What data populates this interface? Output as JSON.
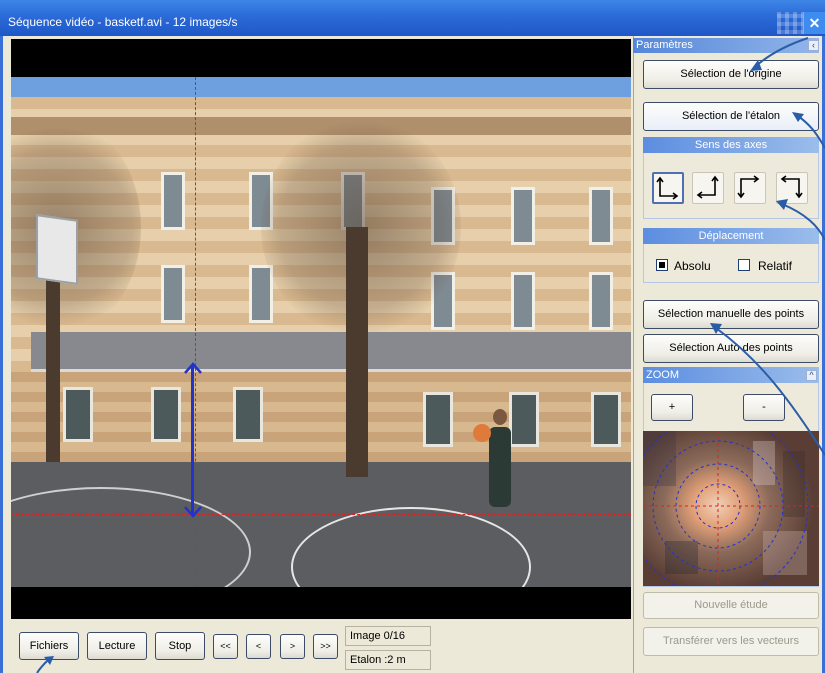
{
  "window": {
    "title": "Séquence vidéo - basketf.avi - 12 images/s",
    "close_glyph": "✕"
  },
  "bottom": {
    "files_label": "Fichiers",
    "play_label": "Lecture",
    "stop_label": "Stop",
    "first_label": "<<",
    "prev_label": "<",
    "next_label": ">",
    "last_label": ">>",
    "image_counter": "Image 0/16",
    "etalon_value": "Etalon :2 m"
  },
  "panel": {
    "header": "Paramètres",
    "origin_button": "Sélection de l'origine",
    "etalon_button": "Sélection de l'étalon",
    "axes_header": "Sens des axes",
    "axes_selected_index": 0,
    "displacement_header": "Déplacement",
    "absolute_label": "Absolu",
    "relative_label": "Relatif",
    "absolute_checked": true,
    "relative_checked": false,
    "manual_points_button": "Sélection manuelle des points",
    "auto_points_button": "Sélection Auto des points",
    "zoom_header": "ZOOM",
    "zoom_in_label": "+",
    "zoom_out_label": "-",
    "new_study_button": "Nouvelle étude",
    "transfer_button": "Transférer vers les vecteurs"
  },
  "colors": {
    "titlebar": "#2b6ad8",
    "panel_header": "#5486d9",
    "guide_line": "#e02020",
    "etalon_line": "#2233cc",
    "annotation_arrow": "#2a5da8"
  }
}
